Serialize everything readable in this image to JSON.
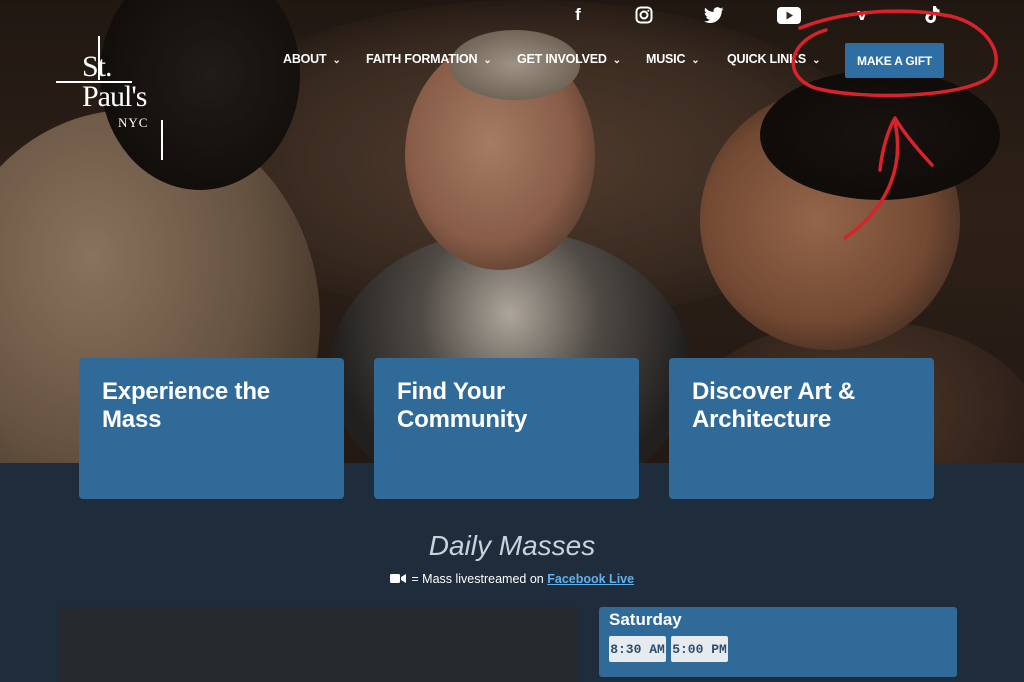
{
  "logo": {
    "line1": "St.",
    "line2": "Paul's",
    "line3": "NYC"
  },
  "social": [
    {
      "icon": "facebook-icon",
      "glyph": "f"
    },
    {
      "icon": "instagram-icon",
      "glyph": ""
    },
    {
      "icon": "twitter-icon",
      "glyph": ""
    },
    {
      "icon": "youtube-icon",
      "glyph": ""
    },
    {
      "icon": "vimeo-icon",
      "glyph": "v"
    },
    {
      "icon": "tiktok-icon",
      "glyph": ""
    }
  ],
  "nav": {
    "about": "ABOUT",
    "faith": "FAITH FORMATION",
    "get_involved": "GET INVOLVED",
    "music": "MUSIC",
    "quick_links": "QUICK LINKS",
    "chevron": "⌄"
  },
  "gift_button": "MAKE A GIFT",
  "annotation_color": "#d8232a",
  "cards": [
    {
      "title": "Experience the Mass"
    },
    {
      "title": "Find Your Community"
    },
    {
      "title": "Discover Art & Architecture"
    }
  ],
  "daily_masses": {
    "title": "Daily Masses",
    "note_prefix": "= Mass livestreamed on",
    "note_link": "Facebook Live"
  },
  "schedule": {
    "day": "Saturday",
    "times": [
      "8:30 AM",
      "5:00 PM"
    ]
  },
  "colors": {
    "card_blue": "#2f6a99",
    "button_blue": "#2f6ea3",
    "background": "#1e2c3b",
    "link": "#5fb2ef"
  }
}
